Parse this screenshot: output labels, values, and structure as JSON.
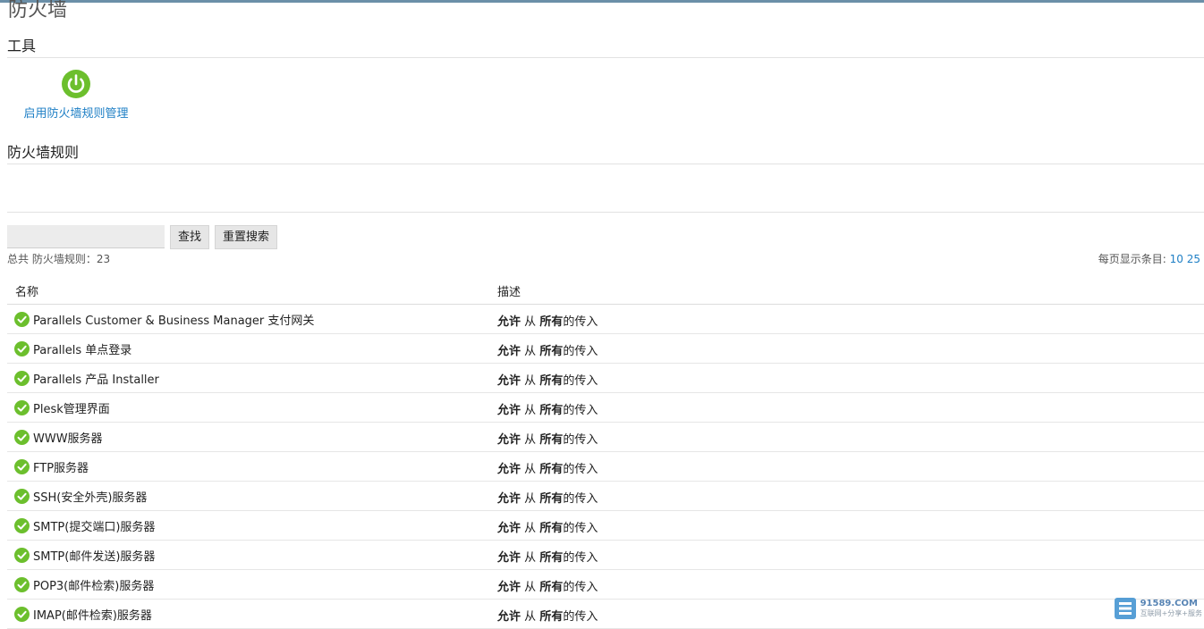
{
  "page": {
    "title": "防火墙"
  },
  "tools": {
    "heading": "工具",
    "enable_label": "启用防火墙规则管理"
  },
  "rules": {
    "heading": "防火墙规则",
    "search": {
      "value": "",
      "placeholder": ""
    },
    "find_button": "查找",
    "reset_button": "重置搜索",
    "total_label": "总共 防火墙规则：23",
    "per_page": {
      "label": "每页显示条目:",
      "options": [
        "10",
        "25"
      ]
    },
    "columns": {
      "name": "名称",
      "description": "描述"
    },
    "desc_parts": {
      "allow": "允许",
      "from": "从",
      "all": "所有",
      "incoming": "的传入"
    },
    "items": [
      {
        "name": "Parallels Customer & Business Manager 支付网关"
      },
      {
        "name": "Parallels 单点登录"
      },
      {
        "name": "Parallels 产品 Installer"
      },
      {
        "name": "Plesk管理界面"
      },
      {
        "name": "WWW服务器"
      },
      {
        "name": "FTP服务器"
      },
      {
        "name": "SSH(安全外壳)服务器"
      },
      {
        "name": "SMTP(提交端口)服务器"
      },
      {
        "name": "SMTP(邮件发送)服务器"
      },
      {
        "name": "POP3(邮件检索)服务器"
      },
      {
        "name": "IMAP(邮件检索)服务器"
      }
    ]
  },
  "watermark": {
    "domain": "91589.COM",
    "sub": "互联网+分享+服务"
  },
  "colors": {
    "accent_link": "#1e7fc5",
    "status_green": "#6cbf2d",
    "top_bar": "#6b8fa8"
  },
  "icons": {
    "tool": "power-icon",
    "row_status": "check-circle-icon"
  }
}
